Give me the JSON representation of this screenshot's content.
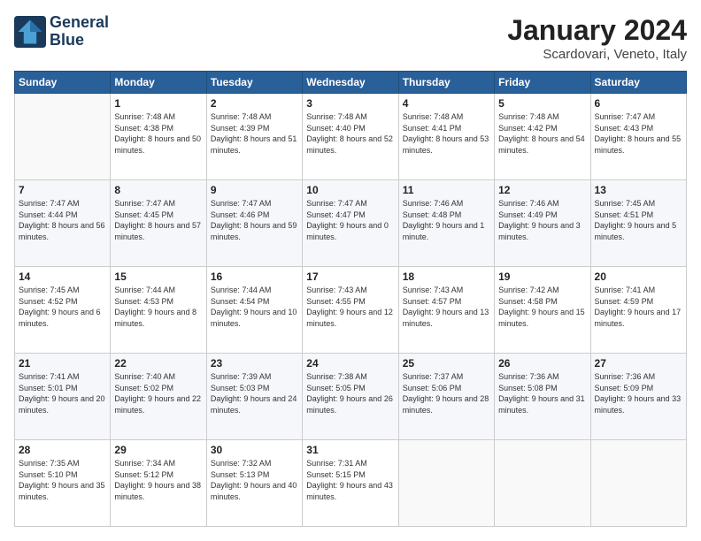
{
  "header": {
    "logo_line1": "General",
    "logo_line2": "Blue",
    "title": "January 2024",
    "subtitle": "Scardovari, Veneto, Italy"
  },
  "days_of_week": [
    "Sunday",
    "Monday",
    "Tuesday",
    "Wednesday",
    "Thursday",
    "Friday",
    "Saturday"
  ],
  "weeks": [
    [
      {
        "day": "",
        "sunrise": "",
        "sunset": "",
        "daylight": ""
      },
      {
        "day": "1",
        "sunrise": "Sunrise: 7:48 AM",
        "sunset": "Sunset: 4:38 PM",
        "daylight": "Daylight: 8 hours and 50 minutes."
      },
      {
        "day": "2",
        "sunrise": "Sunrise: 7:48 AM",
        "sunset": "Sunset: 4:39 PM",
        "daylight": "Daylight: 8 hours and 51 minutes."
      },
      {
        "day": "3",
        "sunrise": "Sunrise: 7:48 AM",
        "sunset": "Sunset: 4:40 PM",
        "daylight": "Daylight: 8 hours and 52 minutes."
      },
      {
        "day": "4",
        "sunrise": "Sunrise: 7:48 AM",
        "sunset": "Sunset: 4:41 PM",
        "daylight": "Daylight: 8 hours and 53 minutes."
      },
      {
        "day": "5",
        "sunrise": "Sunrise: 7:48 AM",
        "sunset": "Sunset: 4:42 PM",
        "daylight": "Daylight: 8 hours and 54 minutes."
      },
      {
        "day": "6",
        "sunrise": "Sunrise: 7:47 AM",
        "sunset": "Sunset: 4:43 PM",
        "daylight": "Daylight: 8 hours and 55 minutes."
      }
    ],
    [
      {
        "day": "7",
        "sunrise": "Sunrise: 7:47 AM",
        "sunset": "Sunset: 4:44 PM",
        "daylight": "Daylight: 8 hours and 56 minutes."
      },
      {
        "day": "8",
        "sunrise": "Sunrise: 7:47 AM",
        "sunset": "Sunset: 4:45 PM",
        "daylight": "Daylight: 8 hours and 57 minutes."
      },
      {
        "day": "9",
        "sunrise": "Sunrise: 7:47 AM",
        "sunset": "Sunset: 4:46 PM",
        "daylight": "Daylight: 8 hours and 59 minutes."
      },
      {
        "day": "10",
        "sunrise": "Sunrise: 7:47 AM",
        "sunset": "Sunset: 4:47 PM",
        "daylight": "Daylight: 9 hours and 0 minutes."
      },
      {
        "day": "11",
        "sunrise": "Sunrise: 7:46 AM",
        "sunset": "Sunset: 4:48 PM",
        "daylight": "Daylight: 9 hours and 1 minute."
      },
      {
        "day": "12",
        "sunrise": "Sunrise: 7:46 AM",
        "sunset": "Sunset: 4:49 PM",
        "daylight": "Daylight: 9 hours and 3 minutes."
      },
      {
        "day": "13",
        "sunrise": "Sunrise: 7:45 AM",
        "sunset": "Sunset: 4:51 PM",
        "daylight": "Daylight: 9 hours and 5 minutes."
      }
    ],
    [
      {
        "day": "14",
        "sunrise": "Sunrise: 7:45 AM",
        "sunset": "Sunset: 4:52 PM",
        "daylight": "Daylight: 9 hours and 6 minutes."
      },
      {
        "day": "15",
        "sunrise": "Sunrise: 7:44 AM",
        "sunset": "Sunset: 4:53 PM",
        "daylight": "Daylight: 9 hours and 8 minutes."
      },
      {
        "day": "16",
        "sunrise": "Sunrise: 7:44 AM",
        "sunset": "Sunset: 4:54 PM",
        "daylight": "Daylight: 9 hours and 10 minutes."
      },
      {
        "day": "17",
        "sunrise": "Sunrise: 7:43 AM",
        "sunset": "Sunset: 4:55 PM",
        "daylight": "Daylight: 9 hours and 12 minutes."
      },
      {
        "day": "18",
        "sunrise": "Sunrise: 7:43 AM",
        "sunset": "Sunset: 4:57 PM",
        "daylight": "Daylight: 9 hours and 13 minutes."
      },
      {
        "day": "19",
        "sunrise": "Sunrise: 7:42 AM",
        "sunset": "Sunset: 4:58 PM",
        "daylight": "Daylight: 9 hours and 15 minutes."
      },
      {
        "day": "20",
        "sunrise": "Sunrise: 7:41 AM",
        "sunset": "Sunset: 4:59 PM",
        "daylight": "Daylight: 9 hours and 17 minutes."
      }
    ],
    [
      {
        "day": "21",
        "sunrise": "Sunrise: 7:41 AM",
        "sunset": "Sunset: 5:01 PM",
        "daylight": "Daylight: 9 hours and 20 minutes."
      },
      {
        "day": "22",
        "sunrise": "Sunrise: 7:40 AM",
        "sunset": "Sunset: 5:02 PM",
        "daylight": "Daylight: 9 hours and 22 minutes."
      },
      {
        "day": "23",
        "sunrise": "Sunrise: 7:39 AM",
        "sunset": "Sunset: 5:03 PM",
        "daylight": "Daylight: 9 hours and 24 minutes."
      },
      {
        "day": "24",
        "sunrise": "Sunrise: 7:38 AM",
        "sunset": "Sunset: 5:05 PM",
        "daylight": "Daylight: 9 hours and 26 minutes."
      },
      {
        "day": "25",
        "sunrise": "Sunrise: 7:37 AM",
        "sunset": "Sunset: 5:06 PM",
        "daylight": "Daylight: 9 hours and 28 minutes."
      },
      {
        "day": "26",
        "sunrise": "Sunrise: 7:36 AM",
        "sunset": "Sunset: 5:08 PM",
        "daylight": "Daylight: 9 hours and 31 minutes."
      },
      {
        "day": "27",
        "sunrise": "Sunrise: 7:36 AM",
        "sunset": "Sunset: 5:09 PM",
        "daylight": "Daylight: 9 hours and 33 minutes."
      }
    ],
    [
      {
        "day": "28",
        "sunrise": "Sunrise: 7:35 AM",
        "sunset": "Sunset: 5:10 PM",
        "daylight": "Daylight: 9 hours and 35 minutes."
      },
      {
        "day": "29",
        "sunrise": "Sunrise: 7:34 AM",
        "sunset": "Sunset: 5:12 PM",
        "daylight": "Daylight: 9 hours and 38 minutes."
      },
      {
        "day": "30",
        "sunrise": "Sunrise: 7:32 AM",
        "sunset": "Sunset: 5:13 PM",
        "daylight": "Daylight: 9 hours and 40 minutes."
      },
      {
        "day": "31",
        "sunrise": "Sunrise: 7:31 AM",
        "sunset": "Sunset: 5:15 PM",
        "daylight": "Daylight: 9 hours and 43 minutes."
      },
      {
        "day": "",
        "sunrise": "",
        "sunset": "",
        "daylight": ""
      },
      {
        "day": "",
        "sunrise": "",
        "sunset": "",
        "daylight": ""
      },
      {
        "day": "",
        "sunrise": "",
        "sunset": "",
        "daylight": ""
      }
    ]
  ]
}
